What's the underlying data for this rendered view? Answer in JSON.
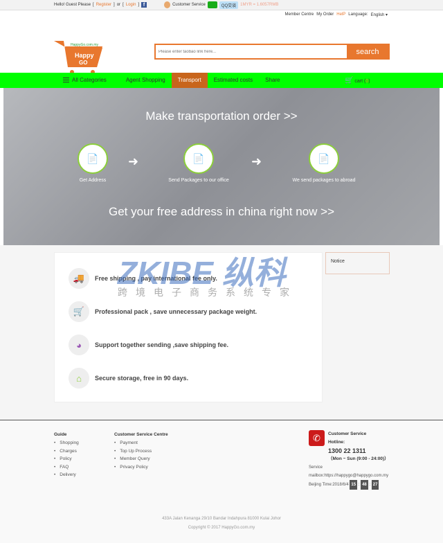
{
  "topbar": {
    "hello": "Hello! Guest Please",
    "register": "Register",
    "or": "or",
    "login": "Login",
    "customer_service": "Customer Service",
    "qq": "QQ交谈",
    "rate": "1MYR = 1.6057RMB"
  },
  "header": {
    "links": [
      "Member Centre",
      "My Order",
      "HelP",
      "Language:",
      "English ▾"
    ],
    "logo_text": "HappyGo.com.my Happy GO",
    "search_placeholder": "Please enter taobao link here...",
    "search_label": "search"
  },
  "nav": {
    "all_categories": "All Categories",
    "items": [
      "Agent Shopping",
      "Transport",
      "Estimated costs",
      "Share"
    ],
    "active": "Transport",
    "cart_label": "cart",
    "cart_count": "0"
  },
  "colors": {
    "accent": "#e8772e",
    "nav": "#00ff00",
    "active": "#c8651c"
  },
  "banner": {
    "title": "Make transportation order >>",
    "steps": [
      "Get Address",
      "Send Packages to our office",
      "We send packages to abroad"
    ],
    "subtitle": "Get your free address in china right now >>"
  },
  "features": [
    "Free shipping , pay international fee only.",
    "Professional pack , save unnecessary package weight.",
    "Support together sending ,save shipping fee.",
    "Secure storage, free in 90 days."
  ],
  "notice": "Notice",
  "watermark": {
    "brand": "ZKIBE纵科®",
    "tagline": "跨境电子商务系统专家"
  },
  "footer": {
    "guide_title": "Guide",
    "guide": [
      "Shopping",
      "Charges",
      "Policy",
      "FAQ",
      "Delivery"
    ],
    "csc_title": "Customer Service Centre",
    "csc": [
      "Payment",
      "Top Up Process",
      "Member Query",
      "Privacy Policy"
    ],
    "cs_title": "Customer Service",
    "hotline_label": "Hotline:",
    "hotline": "1300 22 1311",
    "hours": "（Mon ~ Sun (9:00 - 24:00)）",
    "mailbox_label": "Service",
    "mailbox": "mailbox:https://happygo@happygo.com.my",
    "time_label": "Beijing Time:2018/6/4",
    "hh": "15",
    "mm": "48",
    "ss": "27",
    "address": "433A Jalan Kenanga 29/10 Bandar Indahpura 81000 Kulai Johor",
    "copyright": "Copyright © 2017 HappyGo.com.my"
  }
}
